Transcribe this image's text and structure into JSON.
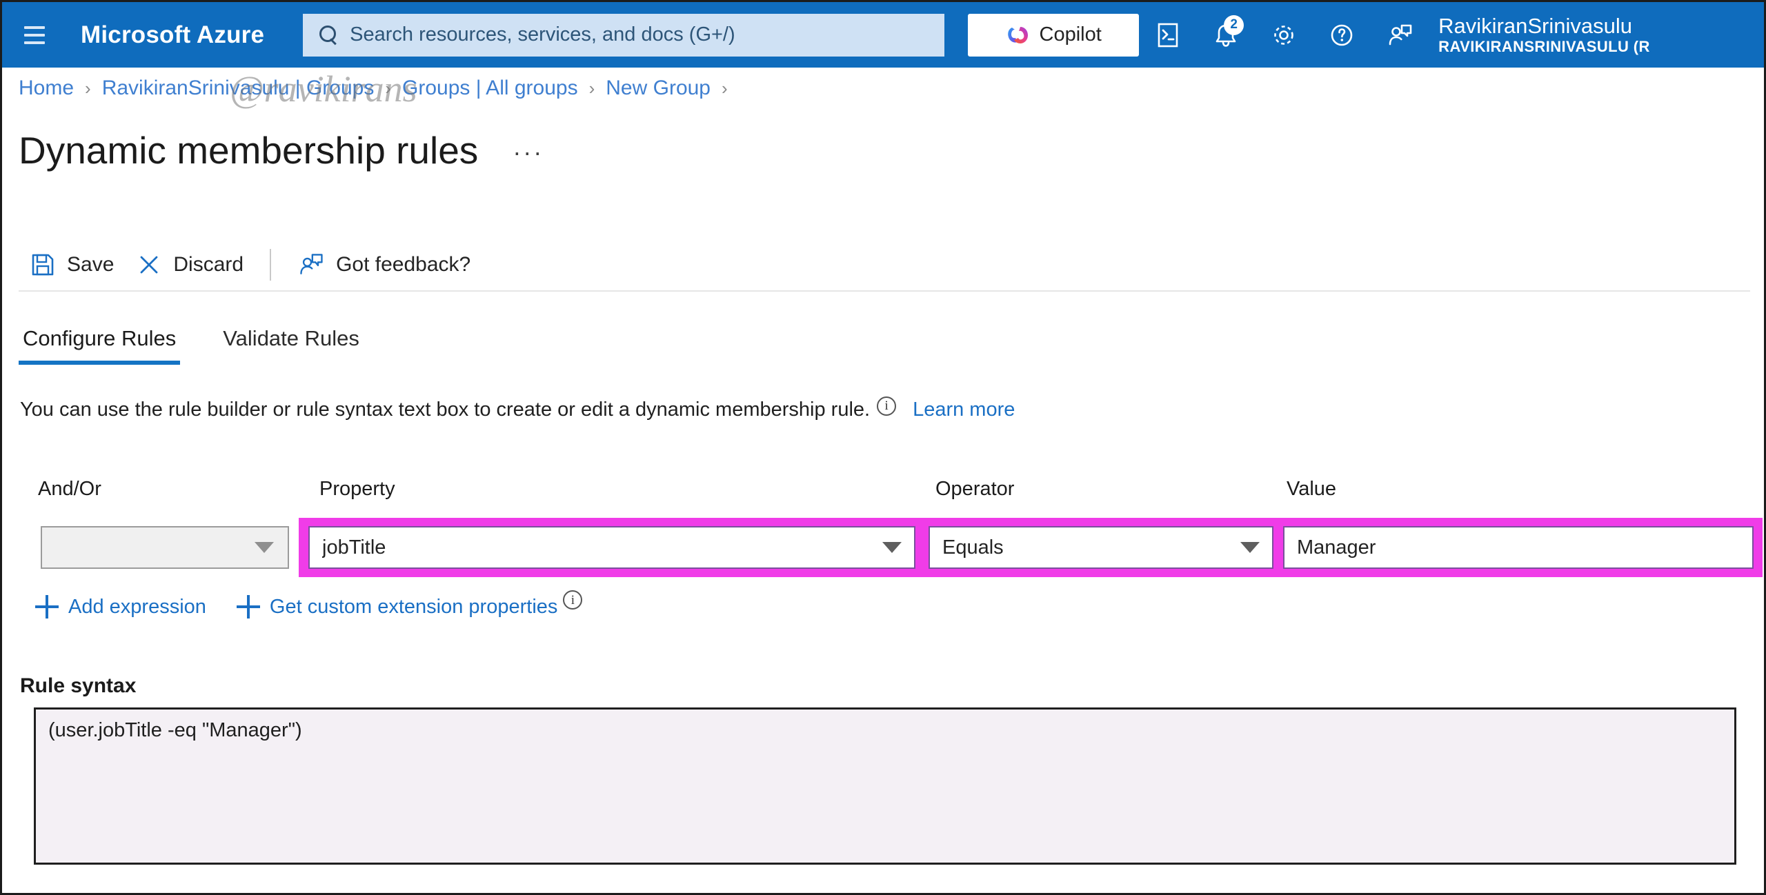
{
  "topbar": {
    "menu_icon": "hamburger-icon",
    "brand": "Microsoft Azure",
    "search": {
      "placeholder": "Search resources, services, and docs (G+/)",
      "icon": "search-icon",
      "value": ""
    },
    "copilot": {
      "label": "Copilot",
      "icon": "copilot-icon"
    },
    "icons": [
      {
        "name": "cloud-shell-icon",
        "label": "Cloud Shell"
      },
      {
        "name": "notifications-bell-icon",
        "label": "Notifications",
        "badge": "2"
      },
      {
        "name": "gear-icon",
        "label": "Settings"
      },
      {
        "name": "help-question-icon",
        "label": "Help"
      },
      {
        "name": "feedback-person-icon",
        "label": "Feedback"
      }
    ],
    "account": {
      "name": "RavikiranSrinivasulu",
      "org": "RAVIKIRANSRINIVASULU (R"
    },
    "accent_color": "#0f6cbd"
  },
  "watermark": {
    "text": "@ravikirans"
  },
  "breadcrumb": {
    "items": [
      "Home",
      "RavikiranSrinivasulu | Groups",
      "Groups | All groups",
      "New Group"
    ],
    "separator": "›",
    "trailing_separator": "›"
  },
  "page": {
    "title": "Dynamic membership rules",
    "ellipsis": "···"
  },
  "command_bar": {
    "items": [
      {
        "label": "Save",
        "icon": "save-disk-icon"
      },
      {
        "label": "Discard",
        "icon": "close-x-icon"
      },
      {
        "label": "Got feedback?",
        "icon": "feedback-person-icon"
      }
    ]
  },
  "tabs": [
    {
      "label": "Configure Rules",
      "active": true
    },
    {
      "label": "Validate Rules",
      "active": false
    }
  ],
  "description": {
    "text": "You can use the rule builder or rule syntax text box to create or edit a dynamic membership rule.",
    "info_icon": "info-circle-icon",
    "learn_more": "Learn more"
  },
  "rule_builder": {
    "headers": {
      "and_or": "And/Or",
      "property": "Property",
      "operator": "Operator",
      "value": "Value"
    },
    "row": {
      "and_or_value": "",
      "property_value": "jobTitle",
      "operator_value": "Equals",
      "value_value": "Manager",
      "value_placeholder": ""
    },
    "highlight_color": "#f03ce8"
  },
  "actions": {
    "add_expression": "Add expression",
    "get_custom_extension_properties": "Get custom extension properties",
    "info_icon": "info-circle-icon"
  },
  "rule_syntax": {
    "label": "Rule syntax",
    "value": "(user.jobTitle -eq \"Manager\")"
  }
}
